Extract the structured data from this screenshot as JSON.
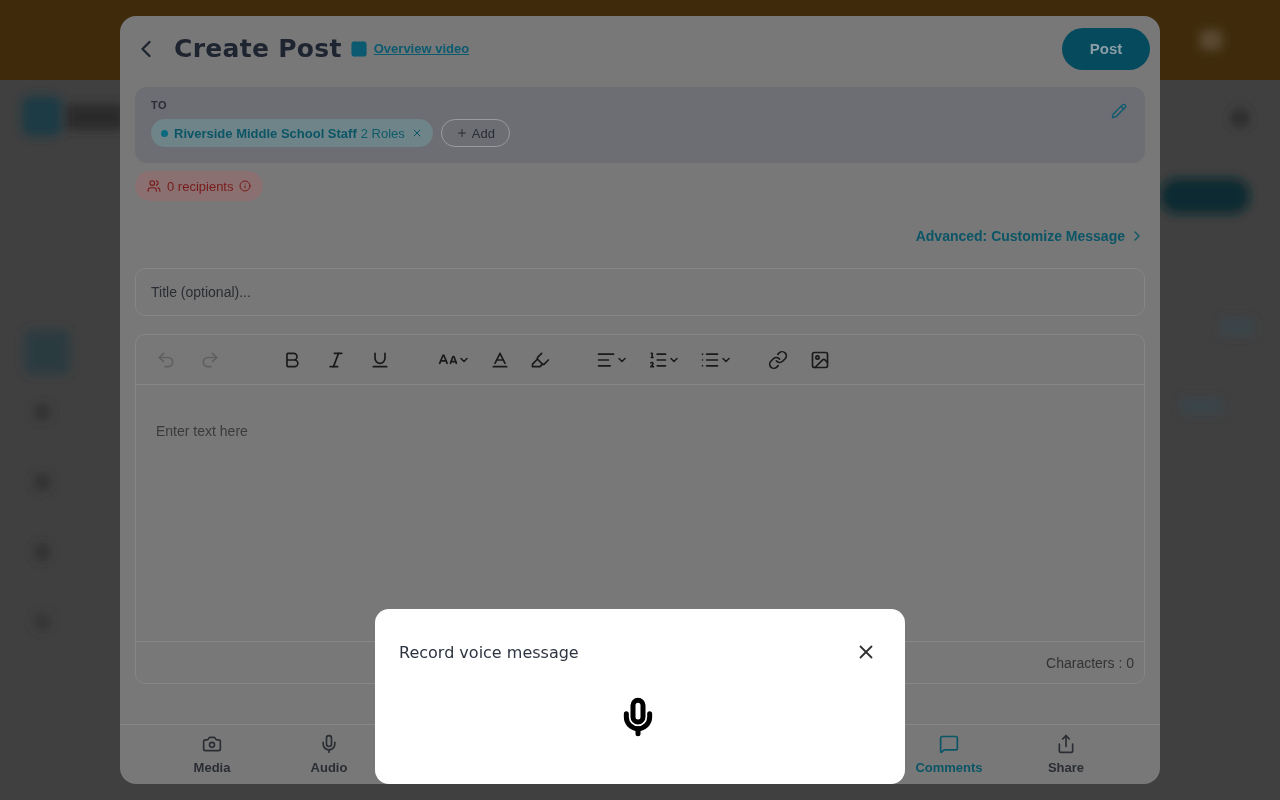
{
  "create_post": {
    "title": "Create Post",
    "overview_link": "Overview video",
    "post_button": "Post",
    "to": {
      "label": "TO",
      "recipients": [
        {
          "name": "Riverside Middle School Staff",
          "roles": "2 Roles"
        }
      ],
      "add_button": "Add"
    },
    "recipient_count": "0 recipients",
    "advanced_link": "Advanced: Customize Message",
    "title_field": {
      "placeholder": "Title (optional)..."
    },
    "editor": {
      "toolbar": [
        {
          "kind": "undo",
          "disabled": true
        },
        {
          "kind": "redo",
          "disabled": true
        },
        {
          "kind": "bold",
          "disabled": false
        },
        {
          "kind": "italic",
          "disabled": false
        },
        {
          "kind": "underline",
          "disabled": false
        },
        {
          "kind": "font-size",
          "disabled": false
        },
        {
          "kind": "text-color",
          "disabled": false
        },
        {
          "kind": "highlight",
          "disabled": false
        },
        {
          "kind": "align",
          "disabled": false
        },
        {
          "kind": "ordered-list",
          "disabled": false
        },
        {
          "kind": "bullet-list",
          "disabled": false
        },
        {
          "kind": "link",
          "disabled": false
        },
        {
          "kind": "image",
          "disabled": false
        }
      ],
      "placeholder": "Enter text here",
      "character_count": "Characters : 0"
    },
    "footer": {
      "left": [
        {
          "kind": "media",
          "label": "Media",
          "selected": false
        },
        {
          "kind": "audio",
          "label": "Audio",
          "selected": false
        }
      ],
      "right": [
        {
          "kind": "comments",
          "label": "Comments",
          "selected": true
        },
        {
          "kind": "share",
          "label": "Share",
          "selected": false
        }
      ]
    }
  },
  "voice_dialog": {
    "title": "Record voice message"
  }
}
